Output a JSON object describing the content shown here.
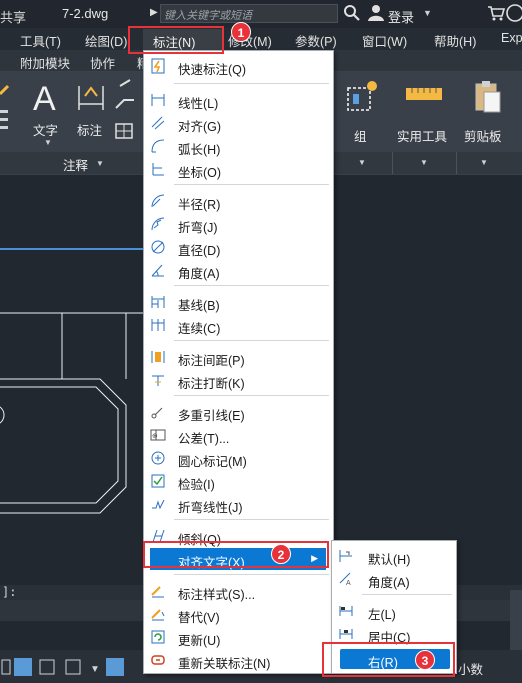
{
  "titlebar": {
    "share": "共享",
    "doc_name": "7-2.dwg",
    "search_placeholder": "键入关键字或短语",
    "login": "登录"
  },
  "menubar": {
    "items": [
      "工具(T)",
      "绘图(D)",
      "标注(N)",
      "修改(M)",
      "参数(P)",
      "窗口(W)",
      "帮助(H)",
      "Exp"
    ],
    "active_index": 2
  },
  "ribbon_tabs": [
    "附加模块",
    "协作",
    "精"
  ],
  "ribbon": {
    "text_label": "文字",
    "dim_label": "标注",
    "annotation_label": "注释",
    "group_label": "组",
    "utilities_label": "实用工具",
    "clipboard_label": "剪贴板"
  },
  "dim_menu": {
    "items": [
      {
        "label": "快速标注(Q)",
        "icon": "quick-dim-icon"
      },
      {
        "label": "线性(L)",
        "icon": "linear-dim-icon"
      },
      {
        "label": "对齐(G)",
        "icon": "aligned-dim-icon"
      },
      {
        "label": "弧长(H)",
        "icon": "arc-length-icon"
      },
      {
        "label": "坐标(O)",
        "icon": "ordinate-icon"
      },
      {
        "label": "半径(R)",
        "icon": "radius-icon"
      },
      {
        "label": "折弯(J)",
        "icon": "jogged-icon"
      },
      {
        "label": "直径(D)",
        "icon": "diameter-icon"
      },
      {
        "label": "角度(A)",
        "icon": "angular-icon"
      },
      {
        "label": "基线(B)",
        "icon": "baseline-icon"
      },
      {
        "label": "连续(C)",
        "icon": "continue-icon"
      },
      {
        "label": "标注间距(P)",
        "icon": "dim-space-icon"
      },
      {
        "label": "标注打断(K)",
        "icon": "dim-break-icon"
      },
      {
        "label": "多重引线(E)",
        "icon": "multileader-icon"
      },
      {
        "label": "公差(T)...",
        "icon": "tolerance-icon"
      },
      {
        "label": "圆心标记(M)",
        "icon": "center-mark-icon"
      },
      {
        "label": "检验(I)",
        "icon": "inspect-icon"
      },
      {
        "label": "折弯线性(J)",
        "icon": "jogged-linear-icon"
      },
      {
        "label": "倾斜(Q)",
        "icon": "oblique-icon"
      },
      {
        "label": "对齐文字(X)",
        "icon": "align-text-icon"
      },
      {
        "label": "标注样式(S)...",
        "icon": "dim-style-icon"
      },
      {
        "label": "替代(V)",
        "icon": "override-icon"
      },
      {
        "label": "更新(U)",
        "icon": "update-icon"
      },
      {
        "label": "重新关联标注(N)",
        "icon": "reassociate-icon"
      }
    ],
    "highlighted_index": 19
  },
  "align_text_submenu": {
    "items": [
      {
        "label": "默认(H)",
        "icon": "default-pos-icon"
      },
      {
        "label": "角度(A)",
        "icon": "text-angle-icon"
      },
      {
        "label": "左(L)",
        "icon": "left-justify-icon"
      },
      {
        "label": "居中(C)",
        "icon": "center-justify-icon"
      },
      {
        "label": "右(R)",
        "icon": "right-justify-icon"
      }
    ],
    "highlighted_index": 4
  },
  "callouts": [
    "1",
    "2",
    "3"
  ],
  "cmdline": {
    "prompt": "]:"
  },
  "statusbar": {
    "units": "小数"
  },
  "colors": {
    "highlight": "#0b78d4",
    "callout": "#e8323a",
    "menu_bg": "#ffffff",
    "app_bg": "#212830"
  }
}
